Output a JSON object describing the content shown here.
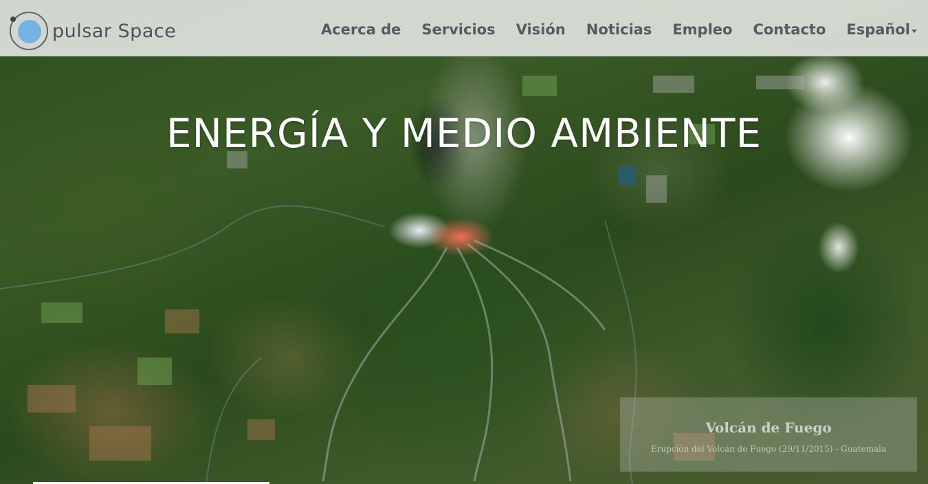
{
  "brand": {
    "logo_text": "pulsar Space",
    "accent_color": "#74b3e3"
  },
  "nav": {
    "items": [
      {
        "label": "Acerca de"
      },
      {
        "label": "Servicios"
      },
      {
        "label": "Visión"
      },
      {
        "label": "Noticias"
      },
      {
        "label": "Empleo"
      },
      {
        "label": "Contacto"
      }
    ],
    "language": {
      "label": "Español",
      "icon": "caret-down-icon"
    }
  },
  "hero": {
    "headline": "ENERGÍA Y MEDIO AMBIENTE",
    "caption": {
      "title": "Volcán de Fuego",
      "subtitle": "Erupción del Volcán de Fuego (29/11/2015) - Guatemala"
    }
  }
}
